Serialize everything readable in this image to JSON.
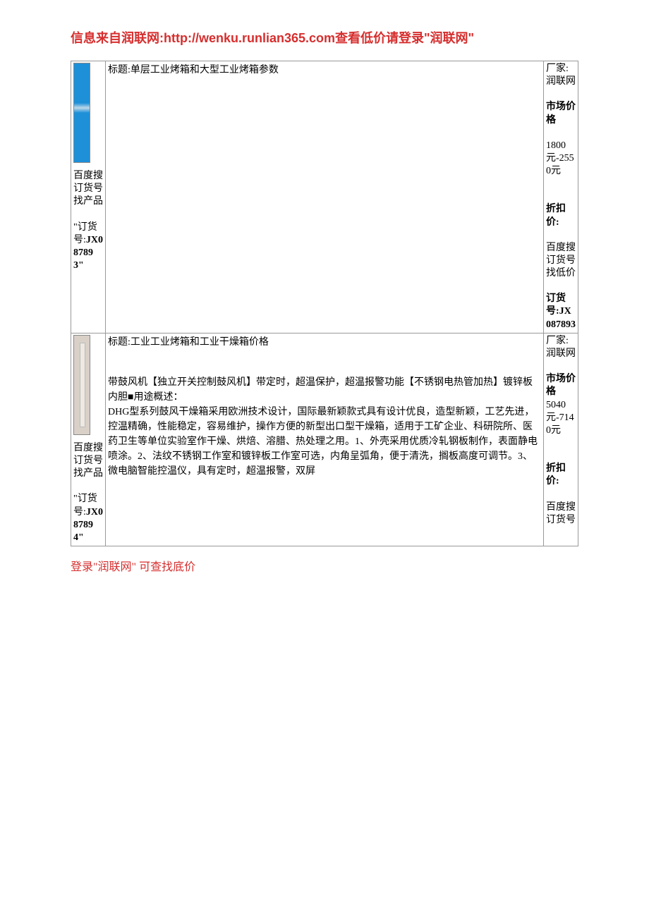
{
  "header": "信息来自润联网:http://wenku.runlian365.com查看低价请登录\"润联网\"",
  "footer": "登录\"润联网\" 可查找底价",
  "rows": [
    {
      "left": {
        "searchTip": "百度搜订货号找产品",
        "orderLabelPrefix": "\"订货号:",
        "orderNumber": "JX087893\""
      },
      "mid": {
        "title": "标题:单层工业烤箱和大型工业烤箱参数",
        "body": ""
      },
      "right": {
        "vendorLabel": "厂家:",
        "vendorValue": "润联网",
        "marketLabel": "市场价格",
        "marketValue": "1800元-2550元",
        "discountLabel": "折扣价:",
        "discountTip": "百度搜订货号找低价",
        "orderLabel": "订货号:",
        "orderValue": "JX087893"
      }
    },
    {
      "left": {
        "searchTip": "百度搜订货号找产品",
        "orderLabelPrefix": "\"订货号:",
        "orderNumber": "JX087894\""
      },
      "mid": {
        "title": "标题:工业工业烤箱和工业干燥箱价格",
        "body": "带鼓风机【独立开关控制鼓风机】带定时，超温保护，超温报警功能【不锈钢电热管加热】镀锌板内胆■用途概述：\nDHG型系列鼓风干燥箱采用欧洲技术设计，国际最新颖款式具有设计优良，造型新颖，工艺先进，控温精确，性能稳定，容易维护，操作方便的新型出口型干燥箱，适用于工矿企业、科研院所、医药卫生等单位实验室作干燥、烘焙、溶腊、热处理之用。1、外壳采用优质冷轧钢板制作，表面静电喷涂。2、法纹不锈钢工作室和镀锌板工作室可选，内角呈弧角，便于清洗，搁板高度可调节。3、微电脑智能控温仪，具有定时，超温报警，双屏"
      },
      "right": {
        "vendorLabel": "厂家:",
        "vendorValue": "润联网",
        "marketLabel": "市场价格",
        "marketValue": "5040元-7140元",
        "discountLabel": "折扣价:",
        "discountTip": "百度搜订货号",
        "orderLabel": "",
        "orderValue": ""
      }
    }
  ]
}
